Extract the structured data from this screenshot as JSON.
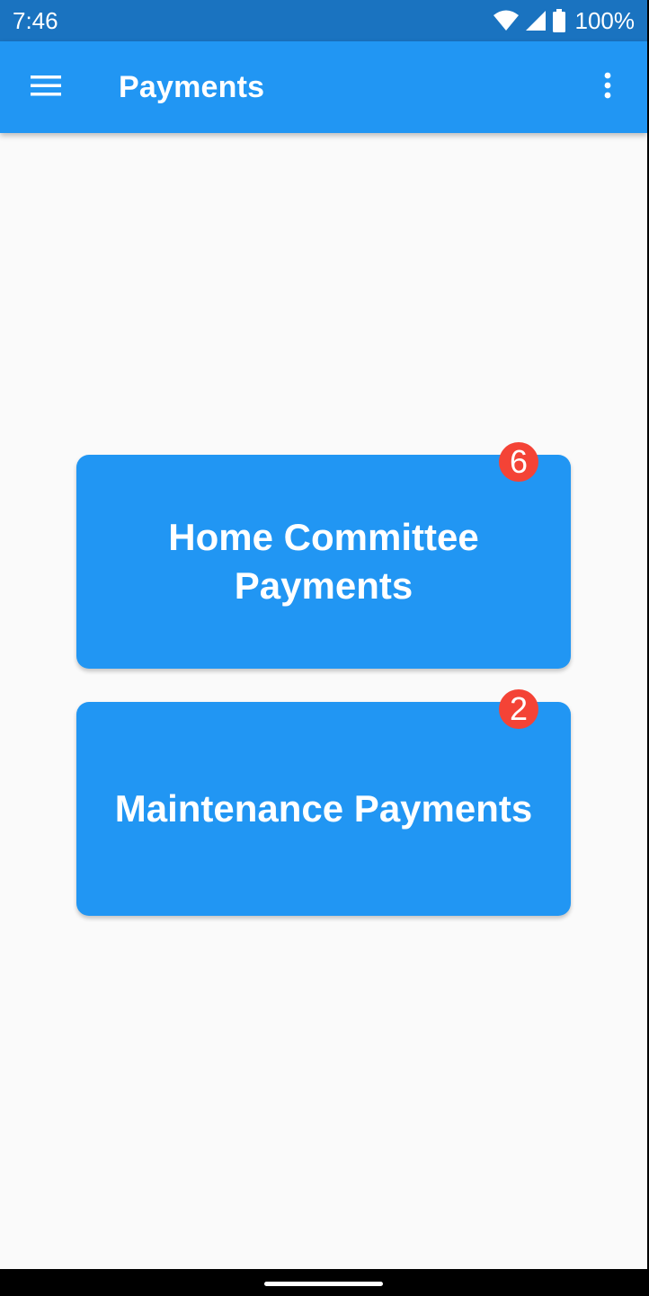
{
  "status_bar": {
    "time": "7:46",
    "battery": "100%"
  },
  "app_bar": {
    "title": "Payments",
    "menu_icon": "menu-icon",
    "overflow_icon": "more-vert-icon"
  },
  "cards": [
    {
      "label": "Home Committee Payments",
      "badge": "6"
    },
    {
      "label": "Maintenance Payments",
      "badge": "2"
    }
  ],
  "colors": {
    "primary": "#2196f3",
    "status_bar": "#1a73c0",
    "badge": "#f44336",
    "background": "#fafafa"
  }
}
